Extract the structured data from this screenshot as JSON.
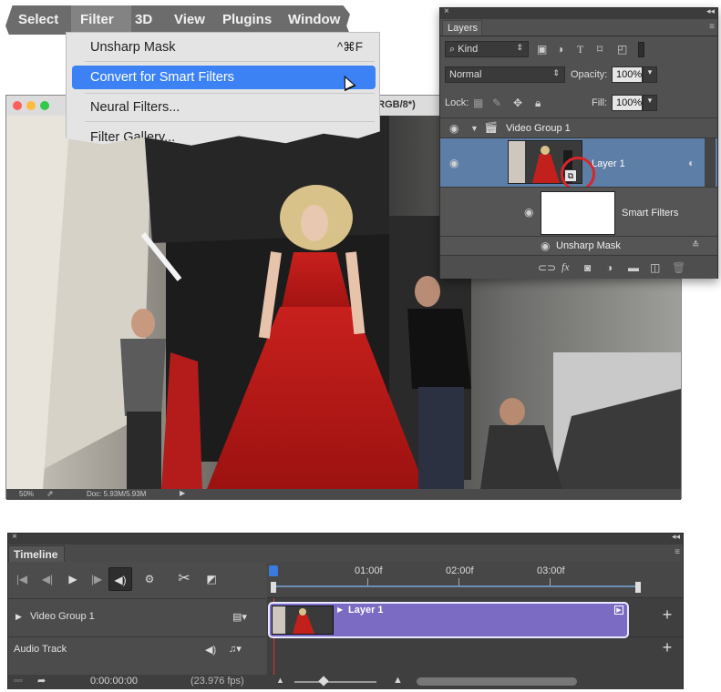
{
  "menubar": {
    "items": [
      "Select",
      "Filter",
      "3D",
      "View",
      "Plugins",
      "Window"
    ]
  },
  "filter_menu": {
    "items": [
      {
        "label": "Unsharp Mask",
        "shortcut": "^⌘F"
      },
      {
        "label": "Convert for Smart Filters",
        "shortcut": ""
      },
      {
        "label": "Neural Filters...",
        "shortcut": ""
      },
      {
        "label": "Filter Gallery...",
        "shortcut": ""
      }
    ]
  },
  "document": {
    "title_fragment": "l, RGB/8*)",
    "zoom": "50%",
    "doc_size": "Doc: 5.93M/5.93M"
  },
  "layers_panel": {
    "tab": "Layers",
    "filter_kind": "Kind",
    "blend_mode": "Normal",
    "opacity_label": "Opacity:",
    "opacity_value": "100%",
    "lock_label": "Lock:",
    "fill_label": "Fill:",
    "fill_value": "100%",
    "group_name": "Video Group 1",
    "layer_name": "Layer 1",
    "smart_filters_label": "Smart Filters",
    "filter_name": "Unsharp Mask",
    "highlight_color": "#d9262b"
  },
  "timeline": {
    "tab": "Timeline",
    "ruler": [
      "01:00f",
      "02:00f",
      "03:00f"
    ],
    "tracks": [
      "Video Group 1",
      "Audio Track"
    ],
    "clip_label": "Layer 1",
    "timecode": "0:00:00:00",
    "fps": "(23.976 fps)",
    "clip_color": "#7b6bc2"
  }
}
